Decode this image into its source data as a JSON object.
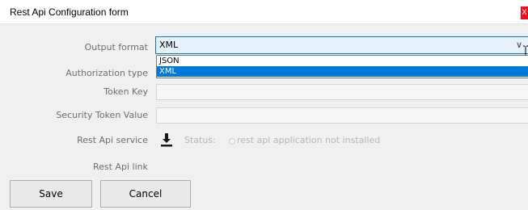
{
  "window": {
    "title": "Rest Api Configuration form",
    "close_label": "X"
  },
  "form": {
    "output_format": {
      "label": "Output format",
      "value": "XML",
      "options": [
        "JSON",
        "XML"
      ],
      "selected": "XML"
    },
    "authorization_type": {
      "label": "Authorization type",
      "value": ""
    },
    "token_key": {
      "label": "Token Key",
      "value": ""
    },
    "security_token_value": {
      "label": "Security Token Value",
      "value": ""
    },
    "rest_api_service": {
      "label": "Rest Api service",
      "status_label": "Status:",
      "status_text": "rest api application not installed",
      "icon": "download-icon"
    },
    "rest_api_link": {
      "label": "Rest Api link"
    }
  },
  "buttons": {
    "save": "Save",
    "cancel": "Cancel"
  },
  "colors": {
    "accent": "#0078d7",
    "close_red": "#e81123"
  }
}
